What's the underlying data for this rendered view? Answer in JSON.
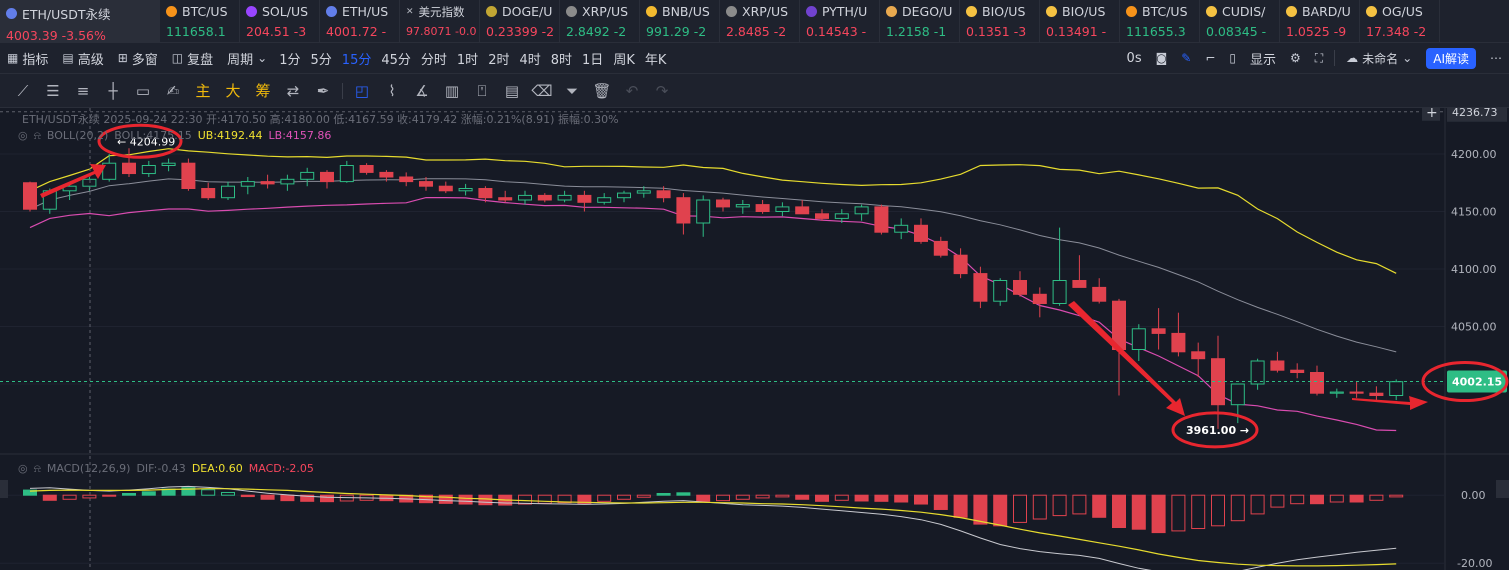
{
  "tickers": [
    {
      "symbol": "ETH/USDT永续",
      "price": "4003.39",
      "change": "-3.56%",
      "dir": "dn",
      "icon_color": "#627eea",
      "active": true,
      "w": 160
    },
    {
      "symbol": "BTC/US",
      "price": "111658.1",
      "change": "",
      "dir": "up",
      "icon_color": "#f7931a",
      "w": 80
    },
    {
      "symbol": "SOL/US",
      "price": "204.51",
      "change": "-3",
      "dir": "dn",
      "icon_color": "#9945ff",
      "w": 80
    },
    {
      "symbol": "ETH/US",
      "price": "4001.72",
      "change": "-",
      "dir": "dn",
      "icon_color": "#627eea",
      "w": 80
    },
    {
      "symbol": "美元指数",
      "price": "97.8071",
      "change": "-0.0",
      "dir": "dn",
      "icon_color": "",
      "w": 80,
      "small": true
    },
    {
      "symbol": "DOGE/U",
      "price": "0.23399",
      "change": "-2",
      "dir": "dn",
      "icon_color": "#c2a633",
      "w": 80
    },
    {
      "symbol": "XRP/US",
      "price": "2.8492",
      "change": "-2",
      "dir": "up",
      "icon_color": "#8b8b8b",
      "w": 80
    },
    {
      "symbol": "BNB/US",
      "price": "991.29",
      "change": "-2",
      "dir": "up",
      "icon_color": "#f3ba2f",
      "w": 80
    },
    {
      "symbol": "XRP/US",
      "price": "2.8485",
      "change": "-2",
      "dir": "dn",
      "icon_color": "#8b8b8b",
      "w": 80
    },
    {
      "symbol": "PYTH/U",
      "price": "0.14543",
      "change": "-",
      "dir": "dn",
      "icon_color": "#7142cf",
      "w": 80
    },
    {
      "symbol": "DEGO/U",
      "price": "1.2158",
      "change": "-1",
      "dir": "up",
      "icon_color": "#e9a94f",
      "w": 80
    },
    {
      "symbol": "BIO/US",
      "price": "0.1351",
      "change": "-3",
      "dir": "dn",
      "icon_color": "#f5c242",
      "w": 80
    },
    {
      "symbol": "BIO/US",
      "price": "0.13491",
      "change": "-",
      "dir": "dn",
      "icon_color": "#f5c242",
      "w": 80
    },
    {
      "symbol": "BTC/US",
      "price": "111655.3",
      "change": "",
      "dir": "up",
      "icon_color": "#f7931a",
      "w": 80
    },
    {
      "symbol": "CUDIS/",
      "price": "0.08345",
      "change": "-",
      "dir": "up",
      "icon_color": "#f5c242",
      "w": 80
    },
    {
      "symbol": "BARD/U",
      "price": "1.0525",
      "change": "-9",
      "dir": "dn",
      "icon_color": "#f5c242",
      "w": 80
    },
    {
      "symbol": "OG/US",
      "price": "17.348",
      "change": "-2",
      "dir": "dn",
      "icon_color": "#f5c242",
      "w": 80
    }
  ],
  "toolbar": {
    "indicators": "指标",
    "advanced": "高级",
    "multiwin": "多窗",
    "replay": "复盘",
    "period": "周期",
    "intervals": [
      "1分",
      "5分",
      "15分",
      "45分",
      "分时",
      "1时",
      "2时",
      "4时",
      "8时",
      "1日",
      "周K",
      "年K"
    ],
    "selected_interval": "15分",
    "countdown": "0s",
    "display": "显示",
    "layout_name": "未命名",
    "ai": "AI解读"
  },
  "drawtools": [
    "主",
    "大",
    "筹"
  ],
  "info": {
    "line": "ETH/USDT永续 2025-09-24 22:30 开:4170.50 高:4180.00 低:4167.59 收:4179.42 涨幅:0.21%(8.91) 振幅:0.30%",
    "boll_label": "BOLL(20,2)",
    "boll_mid": "BOLL:4175.15",
    "boll_ub": "UB:4192.44",
    "boll_lb": "LB:4157.86",
    "macd_label": "MACD(12,26,9)",
    "macd_dif": "DIF:-0.43",
    "macd_dea": "DEA:0.60",
    "macd_val": "MACD:-2.05"
  },
  "chart_data": {
    "type": "candlestick",
    "ylim": [
      3940,
      4240
    ],
    "y_ticks": [
      4200,
      4150,
      4100,
      4050,
      4000
    ],
    "y_tick_labels": [
      "4200.00",
      "4150.00",
      "4100.00",
      "4050.00",
      "4000.00"
    ],
    "top_price": "4236.73",
    "last_price": "4002.15",
    "high_label": "4204.99",
    "low_label": "3961.00",
    "candles": [
      [
        4175,
        4176,
        4150,
        4152
      ],
      [
        4152,
        4170,
        4148,
        4168
      ],
      [
        4168,
        4174,
        4160,
        4172
      ],
      [
        4172,
        4180,
        4168,
        4178
      ],
      [
        4178,
        4200,
        4176,
        4192
      ],
      [
        4192,
        4205,
        4180,
        4183
      ],
      [
        4183,
        4194,
        4180,
        4190
      ],
      [
        4190,
        4196,
        4185,
        4192
      ],
      [
        4192,
        4196,
        4168,
        4170
      ],
      [
        4170,
        4175,
        4160,
        4162
      ],
      [
        4162,
        4176,
        4160,
        4172
      ],
      [
        4172,
        4180,
        4165,
        4176
      ],
      [
        4176,
        4182,
        4170,
        4174
      ],
      [
        4174,
        4182,
        4168,
        4178
      ],
      [
        4178,
        4188,
        4172,
        4184
      ],
      [
        4184,
        4186,
        4170,
        4176
      ],
      [
        4176,
        4194,
        4175,
        4190
      ],
      [
        4190,
        4192,
        4182,
        4184
      ],
      [
        4184,
        4186,
        4176,
        4180
      ],
      [
        4180,
        4184,
        4172,
        4176
      ],
      [
        4176,
        4180,
        4168,
        4172
      ],
      [
        4172,
        4176,
        4166,
        4168
      ],
      [
        4168,
        4174,
        4164,
        4170
      ],
      [
        4170,
        4172,
        4158,
        4162
      ],
      [
        4162,
        4168,
        4158,
        4160
      ],
      [
        4160,
        4168,
        4156,
        4164
      ],
      [
        4164,
        4166,
        4158,
        4160
      ],
      [
        4160,
        4168,
        4158,
        4164
      ],
      [
        4164,
        4168,
        4150,
        4158
      ],
      [
        4158,
        4166,
        4156,
        4162
      ],
      [
        4162,
        4168,
        4158,
        4166
      ],
      [
        4166,
        4172,
        4162,
        4168
      ],
      [
        4168,
        4172,
        4158,
        4162
      ],
      [
        4162,
        4166,
        4130,
        4140
      ],
      [
        4140,
        4164,
        4128,
        4160
      ],
      [
        4160,
        4162,
        4150,
        4154
      ],
      [
        4154,
        4160,
        4148,
        4156
      ],
      [
        4156,
        4160,
        4148,
        4150
      ],
      [
        4150,
        4158,
        4146,
        4154
      ],
      [
        4154,
        4160,
        4148,
        4148
      ],
      [
        4148,
        4152,
        4142,
        4144
      ],
      [
        4144,
        4152,
        4140,
        4148
      ],
      [
        4148,
        4156,
        4142,
        4154
      ],
      [
        4154,
        4156,
        4130,
        4132
      ],
      [
        4132,
        4144,
        4126,
        4138
      ],
      [
        4138,
        4144,
        4122,
        4124
      ],
      [
        4124,
        4128,
        4110,
        4112
      ],
      [
        4112,
        4118,
        4092,
        4096
      ],
      [
        4096,
        4102,
        4066,
        4072
      ],
      [
        4072,
        4092,
        4068,
        4090
      ],
      [
        4090,
        4098,
        4076,
        4078
      ],
      [
        4078,
        4084,
        4058,
        4070
      ],
      [
        4070,
        4136,
        4068,
        4090
      ],
      [
        4090,
        4112,
        4084,
        4084
      ],
      [
        4084,
        4092,
        4070,
        4072
      ],
      [
        4072,
        4074,
        3990,
        4030
      ],
      [
        4030,
        4052,
        4020,
        4048
      ],
      [
        4048,
        4066,
        4030,
        4044
      ],
      [
        4044,
        4062,
        4024,
        4028
      ],
      [
        4028,
        4036,
        4006,
        4022
      ],
      [
        4022,
        4042,
        3961,
        3982
      ],
      [
        3982,
        4000,
        3966,
        4000
      ],
      [
        4000,
        4022,
        3995,
        4020
      ],
      [
        4020,
        4028,
        4010,
        4012
      ],
      [
        4012,
        4018,
        4005,
        4010
      ],
      [
        4010,
        4016,
        3990,
        3992
      ],
      [
        3992,
        3996,
        3988,
        3993
      ],
      [
        3993,
        4002,
        3988,
        3992
      ],
      [
        3992,
        3998,
        3985,
        3990
      ],
      [
        3990,
        4004,
        3986,
        4002
      ]
    ],
    "macd_ylim": [
      -22,
      8
    ],
    "macd_ticks": [
      "0.00",
      "-20.00"
    ],
    "macd_hist": [
      1.5,
      -1.5,
      -1.2,
      -0.8,
      -0.3,
      0.5,
      1,
      1.8,
      2.2,
      1.6,
      0.8,
      -0.4,
      -1.2,
      -1.6,
      -1.8,
      -1.9,
      -1.7,
      -1.5,
      -1.6,
      -2,
      -2.2,
      -2.4,
      -2.6,
      -2.8,
      -2.9,
      -2.6,
      -2.4,
      -2.2,
      -2.4,
      -1.8,
      -1.2,
      -0.6,
      0.5,
      0.7,
      -1.8,
      -1.6,
      -1.2,
      -0.8,
      -0.5,
      -1.2,
      -1.8,
      -1.5,
      -1.7,
      -1.8,
      -2,
      -2.6,
      -4.2,
      -6.5,
      -8.5,
      -9,
      -8,
      -7,
      -6,
      -5.5,
      -6.5,
      -9.5,
      -10,
      -11,
      -10.5,
      -9.8,
      -9,
      -7.5,
      -5.5,
      -3.5,
      -2.5,
      -2.5,
      -2,
      -2,
      -1.5,
      -0.5
    ],
    "macd_dif": [
      2,
      2.2,
      1.8,
      1.4,
      1.2,
      1.5,
      1.9,
      2.4,
      2.6,
      2.3,
      1.9,
      1.2,
      0.6,
      0.1,
      -0.3,
      -0.6,
      -0.7,
      -0.8,
      -0.9,
      -1.1,
      -1.3,
      -1.6,
      -1.8,
      -2.1,
      -2.3,
      -2.4,
      -2.5,
      -2.6,
      -2.7,
      -2.6,
      -2.4,
      -2.1,
      -1.8,
      -1.6,
      -2,
      -2.4,
      -2.8,
      -3,
      -3.2,
      -3.6,
      -4.1,
      -4.6,
      -5.1,
      -5.6,
      -6.3,
      -7.2,
      -8.6,
      -10.5,
      -12.6,
      -14.5,
      -15.7,
      -16.6,
      -17.2,
      -17.7,
      -18.6,
      -20.1,
      -21.5,
      -22.5,
      -23.2,
      -23.5,
      -23.2,
      -22.4,
      -21.2,
      -20,
      -19,
      -18.2,
      -17.5,
      -16.8,
      -16.2,
      -15.6
    ],
    "macd_dea": [
      1.2,
      1.4,
      1.5,
      1.4,
      1.4,
      1.4,
      1.5,
      1.7,
      1.8,
      1.9,
      1.9,
      1.8,
      1.6,
      1.4,
      1.1,
      0.8,
      0.5,
      0.3,
      0.1,
      -0.1,
      -0.4,
      -0.6,
      -0.9,
      -1.1,
      -1.4,
      -1.6,
      -1.8,
      -2,
      -2.1,
      -2.2,
      -2.3,
      -2.3,
      -2.2,
      -2.1,
      -2.1,
      -2.2,
      -2.3,
      -2.5,
      -2.6,
      -2.8,
      -3.1,
      -3.4,
      -3.8,
      -4.1,
      -4.5,
      -5,
      -5.7,
      -6.6,
      -7.7,
      -8.8,
      -10,
      -11.1,
      -12,
      -13,
      -14,
      -15,
      -16.1,
      -17.3,
      -18.3,
      -19.2,
      -19.8,
      -20.3,
      -20.6,
      -20.7,
      -20.8,
      -20.8,
      -20.7,
      -20.6,
      -20.4,
      -20.2
    ]
  }
}
